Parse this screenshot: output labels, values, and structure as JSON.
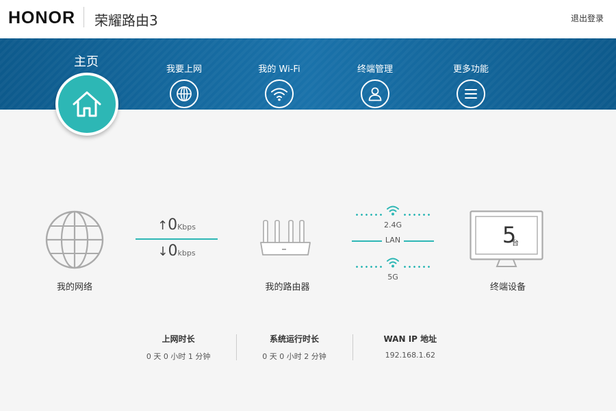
{
  "header": {
    "brand": "HONOR",
    "product": "荣耀路由3",
    "logout": "退出登录"
  },
  "nav": {
    "home": "主页",
    "items": [
      {
        "label": "我要上网",
        "icon": "globe-icon"
      },
      {
        "label": "我的 Wi-Fi",
        "icon": "wifi-icon"
      },
      {
        "label": "终端管理",
        "icon": "user-icon"
      },
      {
        "label": "更多功能",
        "icon": "menu-icon"
      }
    ]
  },
  "status": {
    "network_label": "我的网络",
    "upload_value": "0",
    "upload_unit": "Kbps",
    "download_value": "0",
    "download_unit": "kbps",
    "router_label": "我的路由器",
    "band_24": "2.4G",
    "lan": "LAN",
    "band_5": "5G",
    "device_count": "5",
    "device_unit": "台",
    "devices_label": "终端设备"
  },
  "stats": [
    {
      "key": "上网时长",
      "value": "0 天 0 小时 1 分钟"
    },
    {
      "key": "系统运行时长",
      "value": "0 天 0 小时 2 分钟"
    },
    {
      "key": "WAN IP 地址",
      "value": "192.168.1.62"
    }
  ],
  "colors": {
    "accent": "#2db7b5",
    "nav_band": "#1a72aa"
  }
}
